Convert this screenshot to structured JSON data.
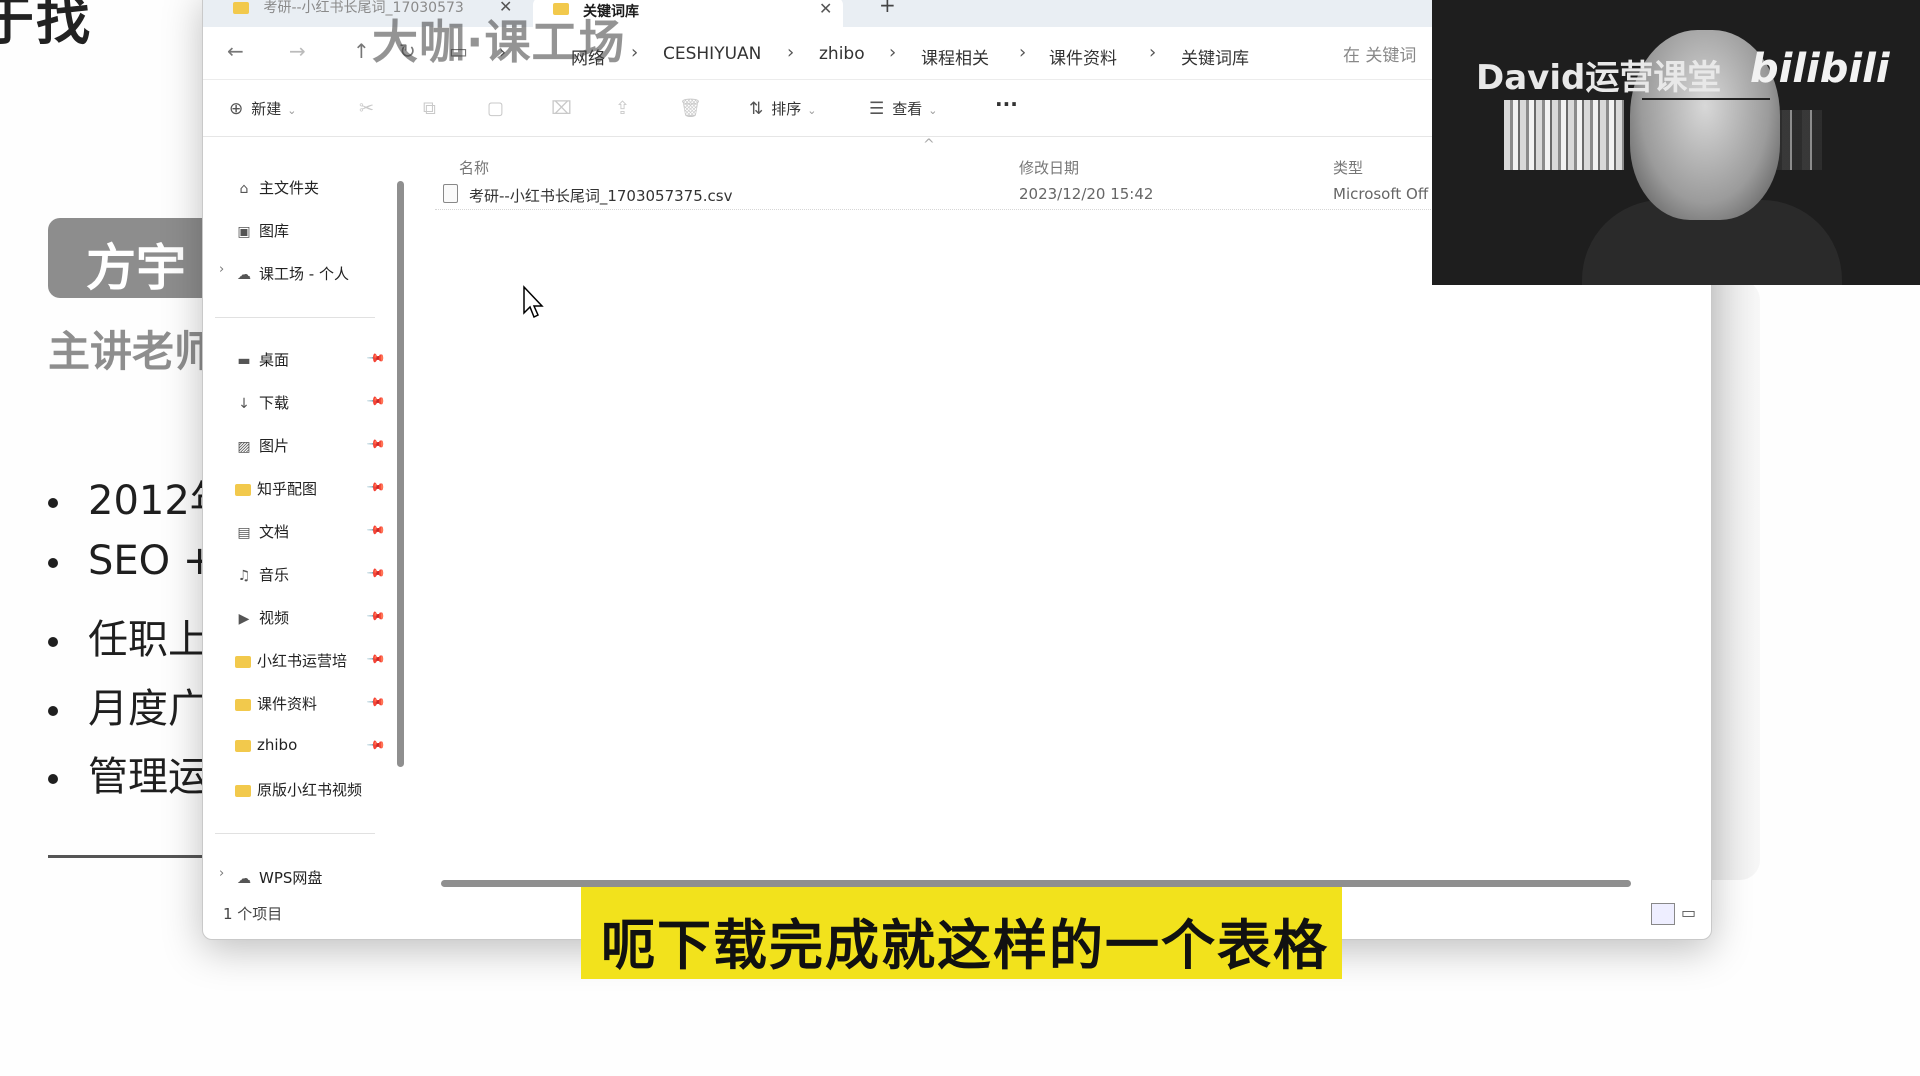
{
  "slide": {
    "heading": "于找",
    "name": "方宇",
    "teacher_label": "主讲老师",
    "bullets": [
      "2012年",
      "SEO +",
      "任职上",
      "月度广",
      "管理运"
    ]
  },
  "explorer": {
    "tabs": [
      {
        "label": "考研--小红书长尾词_17030573"
      },
      {
        "label": "关键词库"
      }
    ],
    "new_tab": "+",
    "nav_icons": [
      "back-arrow",
      "forward-arrow",
      "up-arrow",
      "refresh",
      "monitor"
    ],
    "breadcrumb": [
      "网络",
      "CESHIYUAN",
      "zhibo",
      "课程相关",
      "课件资料",
      "关键词库"
    ],
    "search_placeholder": "在 关键词",
    "toolbar": {
      "new_label": "新建",
      "sort_label": "排序",
      "view_label": "查看",
      "more_label": "···"
    },
    "sidebar": {
      "top_items": [
        {
          "label": "主文件夹",
          "icon": "home"
        },
        {
          "label": "图库",
          "icon": "gallery"
        },
        {
          "label": "课工场 - 个人",
          "icon": "cloud"
        }
      ],
      "pinned_items": [
        {
          "label": "桌面",
          "icon": "desktop"
        },
        {
          "label": "下载",
          "icon": "download"
        },
        {
          "label": "图片",
          "icon": "pictures"
        },
        {
          "label": "知乎配图",
          "icon": "folder"
        },
        {
          "label": "文档",
          "icon": "documents"
        },
        {
          "label": "音乐",
          "icon": "music"
        },
        {
          "label": "视频",
          "icon": "videos"
        },
        {
          "label": "小红书运营培",
          "icon": "folder"
        },
        {
          "label": "课件资料",
          "icon": "folder"
        },
        {
          "label": "zhibo",
          "icon": "folder"
        },
        {
          "label": "原版小红书视频",
          "icon": "folder"
        }
      ],
      "bottom_item": {
        "label": "WPS网盘",
        "icon": "cloud"
      }
    },
    "columns": {
      "name": "名称",
      "date": "修改日期",
      "type": "类型"
    },
    "files": [
      {
        "name": "考研--小红书长尾词_1703057375.csv",
        "date": "2023/12/20 15:42",
        "type": "Microsoft Off"
      }
    ],
    "status": "1 个项目"
  },
  "watermark": "大咖·课工场",
  "webcam": {
    "title": "David运营课堂",
    "logo": "bilibili"
  },
  "subtitle": "呃下载完成就这样的一个表格"
}
